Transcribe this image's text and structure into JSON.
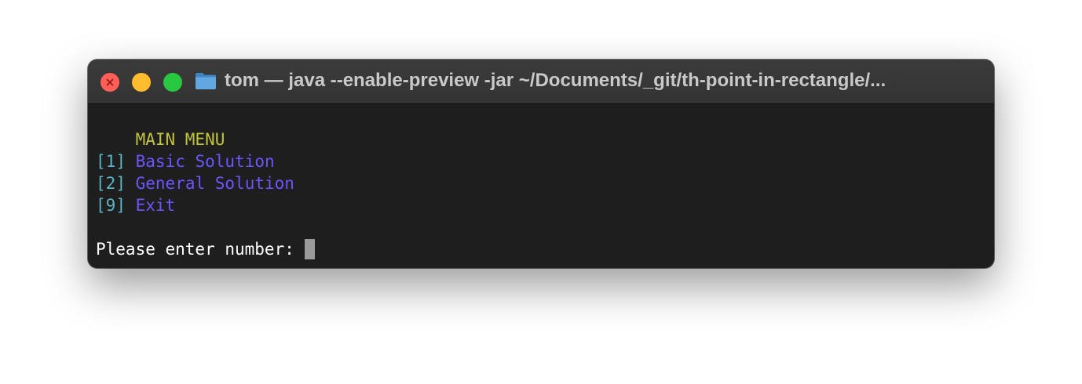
{
  "window": {
    "title": "tom — java --enable-preview -jar ~/Documents/_git/th-point-in-rectangle/..."
  },
  "terminal": {
    "menu_indent": "    ",
    "menu_title": "MAIN MENU",
    "options": [
      {
        "bracket_open": "[",
        "key": "1",
        "bracket_close": "]",
        "label": "Basic Solution"
      },
      {
        "bracket_open": "[",
        "key": "2",
        "bracket_close": "]",
        "label": "General Solution"
      },
      {
        "bracket_open": "[",
        "key": "9",
        "bracket_close": "]",
        "label": "Exit"
      }
    ],
    "prompt": "Please enter number: "
  },
  "colors": {
    "menu_title": "#c3c43c",
    "option_key": "#5ab5c7",
    "option_label": "#6a55ff",
    "prompt": "#ffffff",
    "background": "#1e1e1e"
  },
  "icons": [
    "close-icon",
    "minimize-icon",
    "zoom-icon",
    "folder-icon",
    "cursor"
  ]
}
